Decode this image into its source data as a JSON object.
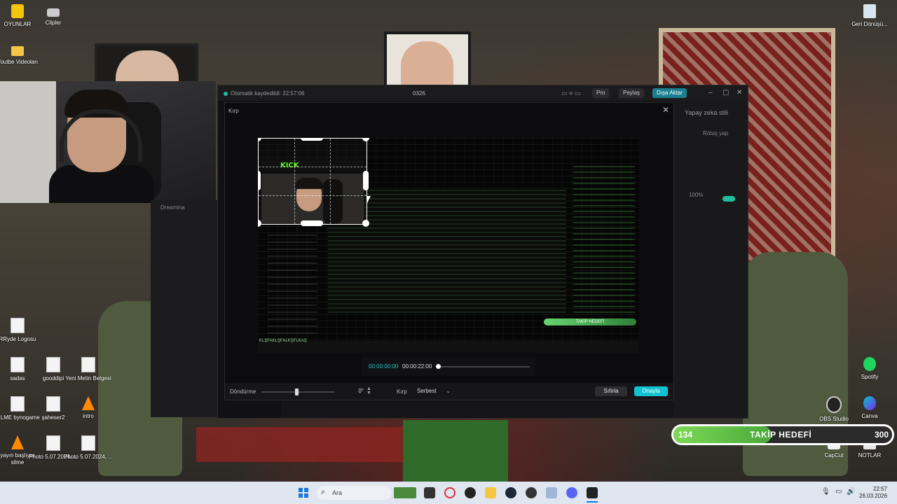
{
  "desktop": {
    "icons_left": [
      {
        "label": "OYUNLAR",
        "icon": "lock-icon"
      },
      {
        "label": "Clipler",
        "icon": "camera-icon"
      },
      {
        "label": "Youtbe Videoları",
        "icon": "folder-icon"
      },
      {
        "label": "RRyde Logosu",
        "icon": "document-icon"
      },
      {
        "label": "sadas",
        "icon": "document-icon"
      },
      {
        "label": "gooddipi",
        "icon": "document-icon"
      },
      {
        "label": "Yeni Metin Belgesi",
        "icon": "text-document-icon"
      },
      {
        "label": "SILME bynogame",
        "icon": "document-icon"
      },
      {
        "label": "şaheser2",
        "icon": "document-icon"
      },
      {
        "label": "intro",
        "icon": "vlc-cone-icon"
      },
      {
        "label": "yayın başlıyor silme",
        "icon": "vlc-cone-icon"
      },
      {
        "label": "Photo 5.07.2024, ...",
        "icon": "document-icon"
      },
      {
        "label": "Photo 5.07.2024, ...",
        "icon": "document-icon"
      }
    ],
    "icons_right": [
      {
        "label": "Geri Dönüşü...",
        "icon": "recycle-bin-icon"
      },
      {
        "label": "Spotify",
        "icon": "spotify-icon"
      },
      {
        "label": "OBS Studio",
        "icon": "obs-icon"
      },
      {
        "label": "Canva",
        "icon": "canva-icon"
      },
      {
        "label": "CapCut",
        "icon": "capcut-icon"
      },
      {
        "label": "NOTLAR",
        "icon": "notes-icon"
      }
    ]
  },
  "capcut": {
    "autosave": "Otomatik kaydedildi: 22:57:06",
    "project_name": "0326",
    "pro_label": "Pro",
    "share_label": "Paylaş",
    "export_label": "Dışa Aktar",
    "left_panel_label": "Dreamina",
    "right_panel": {
      "heading": "Yapay zeka stili",
      "sub": "Rötuş yap",
      "percent": "100%"
    },
    "crop_dialog": {
      "title": "Kırp",
      "kick_logo": "KICK",
      "stream_text_overlay": "KLŞFAKLŞFALKŞFLKAŞ",
      "goal_overlay": "TAKİP HEDEFİ",
      "player": {
        "current": "00:00:00:00",
        "duration": "00:00:22:00"
      },
      "rotate_label": "Döndürme",
      "rotate_value": "0°",
      "crop_label": "Kırp",
      "crop_mode": "Serbest",
      "reset_label": "Sıfırla",
      "confirm_label": "Onayla"
    }
  },
  "follow_goal": {
    "current": "134",
    "title": "TAKİP HEDEFİ",
    "target": "300",
    "progress_fraction": 0.45,
    "fill_color": "#7ed957"
  },
  "taskbar": {
    "search_placeholder": "Ara",
    "time": "22:57",
    "date": "26.03.2026"
  },
  "colors": {
    "accent": "#12c2d2",
    "kick_green": "#53fc18"
  }
}
